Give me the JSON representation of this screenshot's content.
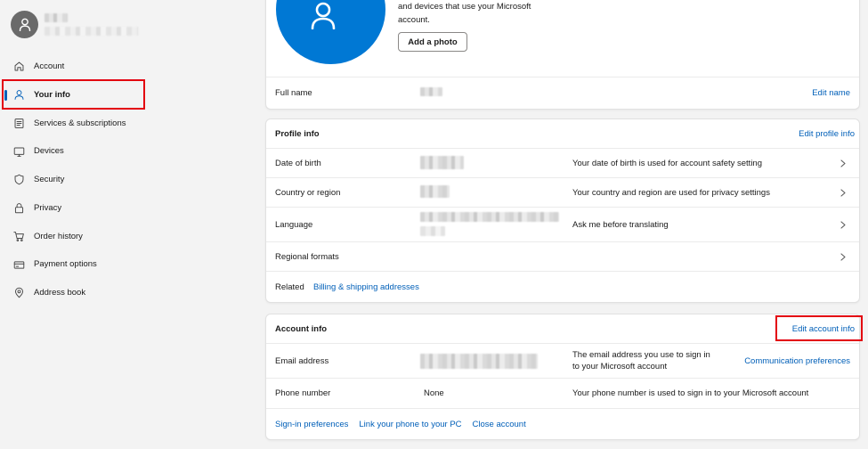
{
  "sidebar": {
    "items": [
      {
        "label": "Account",
        "icon": "home-icon"
      },
      {
        "label": "Your info",
        "icon": "person-icon",
        "selected": true
      },
      {
        "label": "Services & subscriptions",
        "icon": "document-icon"
      },
      {
        "label": "Devices",
        "icon": "monitor-icon"
      },
      {
        "label": "Security",
        "icon": "shield-icon"
      },
      {
        "label": "Privacy",
        "icon": "lock-icon"
      },
      {
        "label": "Order history",
        "icon": "cart-icon"
      },
      {
        "label": "Payment options",
        "icon": "credit-card-icon"
      },
      {
        "label": "Address book",
        "icon": "location-pin-icon"
      }
    ]
  },
  "photo_card": {
    "description_lines": [
      "and devices that use your Microsoft",
      "account."
    ],
    "add_photo_label": "Add a photo",
    "full_name_label": "Full name",
    "edit_name_label": "Edit name"
  },
  "profile_info": {
    "title": "Profile info",
    "edit_label": "Edit profile info",
    "rows": [
      {
        "label": "Date of birth",
        "description": "Your date of birth is used for account safety setting"
      },
      {
        "label": "Country or region",
        "description": "Your country and region are used for privacy settings"
      },
      {
        "label": "Language",
        "description": "Ask me before translating"
      },
      {
        "label": "Regional formats"
      }
    ],
    "related_label": "Related",
    "related_link": "Billing & shipping addresses"
  },
  "account_info": {
    "title": "Account info",
    "edit_label": "Edit account info",
    "email": {
      "label": "Email address",
      "description_lines": [
        "The email address you use to sign in",
        "to your Microsoft account"
      ],
      "link": "Communication preferences"
    },
    "phone": {
      "label": "Phone number",
      "value": "None",
      "description": "Your phone number is used to sign in to your Microsoft account"
    },
    "footer_links": [
      "Sign-in preferences",
      "Link your phone to your PC",
      "Close account"
    ]
  },
  "colors": {
    "accent": "#0078d4",
    "link": "#005fb8",
    "highlight": "#e3000f",
    "selected_indicator": "#005fb8"
  }
}
